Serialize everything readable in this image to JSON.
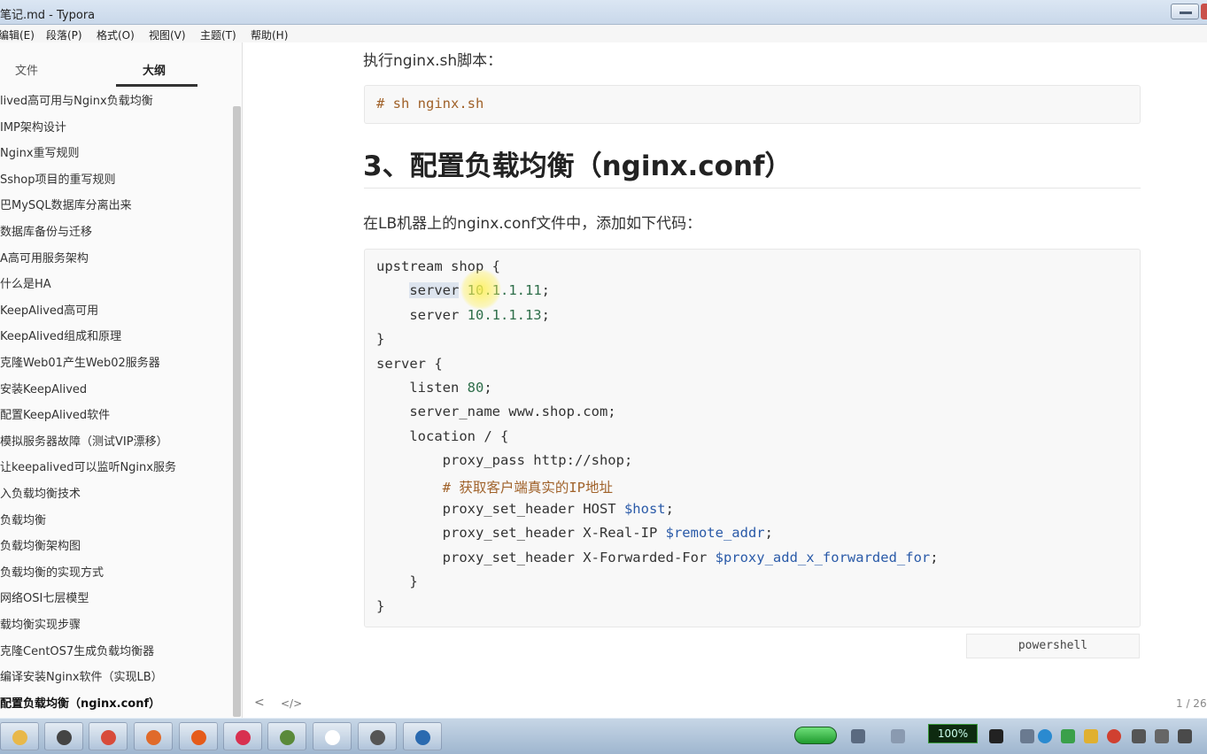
{
  "window": {
    "title": "笔记.md - Typora"
  },
  "menu": [
    "编辑(E)",
    "段落(P)",
    "格式(O)",
    "视图(V)",
    "主题(T)",
    "帮助(H)"
  ],
  "sidebar": {
    "tabs": [
      {
        "label": "文件",
        "active": false
      },
      {
        "label": "大纲",
        "active": true
      }
    ],
    "items": [
      "lived高可用与Nginx负载均衡",
      "IMP架构设计",
      "Nginx重写规则",
      "Sshop项目的重写规则",
      "巴MySQL数据库分离出来",
      "数据库备份与迁移",
      "A高可用服务架构",
      "什么是HA",
      "KeepAlived高可用",
      "KeepAlived组成和原理",
      "克隆Web01产生Web02服务器",
      "安装KeepAlived",
      "配置KeepAlived软件",
      "模拟服务器故障（测试VIP漂移）",
      "让keepalived可以监听Nginx服务",
      "入负载均衡技术",
      "负载均衡",
      "负载均衡架构图",
      "负载均衡的实现方式",
      "网络OSI七层模型",
      "载均衡实现步骤",
      "克隆CentOS7生成负载均衡器",
      "编译安装Nginx软件（实现LB）",
      "配置负载均衡（nginx.conf）"
    ],
    "current_index": 23
  },
  "document": {
    "para1": "执行nginx.sh脚本：",
    "code1": "# sh nginx.sh",
    "heading": "3、配置负载均衡（nginx.conf）",
    "para2": "在LB机器上的nginx.conf文件中，添加如下代码：",
    "code2": [
      "upstream shop {",
      "    server 10.1.1.11;",
      "    server 10.1.1.13;",
      "}",
      "server {",
      "    listen 80;",
      "    server_name www.shop.com;",
      "    location / {",
      "        proxy_pass http://shop;",
      "        # 获取客户端真实的IP地址",
      "        proxy_set_header HOST $host;",
      "        proxy_set_header X-Real-IP $remote_addr;",
      "        proxy_set_header X-Forwarded-For $proxy_add_x_forwarded_for;",
      "    }",
      "}"
    ],
    "code_language": "powershell"
  },
  "status": {
    "back_icon": "chevron-left-icon",
    "source_icon": "source-code-icon",
    "source_label": "</>",
    "back_label": "<",
    "word_count": "1 / 26"
  },
  "taskbar": {
    "apps": [
      {
        "icon": "file-explorer-icon",
        "color": "#e8b84a"
      },
      {
        "icon": "ghost-icon",
        "color": "#444"
      },
      {
        "icon": "chrome-icon",
        "color": "#d84b3a"
      },
      {
        "icon": "browser-icon",
        "color": "#e06a2a"
      },
      {
        "icon": "firefox-icon",
        "color": "#e55b1a"
      },
      {
        "icon": "app-red-icon",
        "color": "#d83050"
      },
      {
        "icon": "terminal-icon",
        "color": "#5a8a3a"
      },
      {
        "icon": "typora-icon",
        "color": "#ffffff"
      },
      {
        "icon": "vm-icon",
        "color": "#555"
      },
      {
        "icon": "xshell-icon",
        "color": "#2a6ab0"
      }
    ],
    "battery_percent": "100%"
  }
}
